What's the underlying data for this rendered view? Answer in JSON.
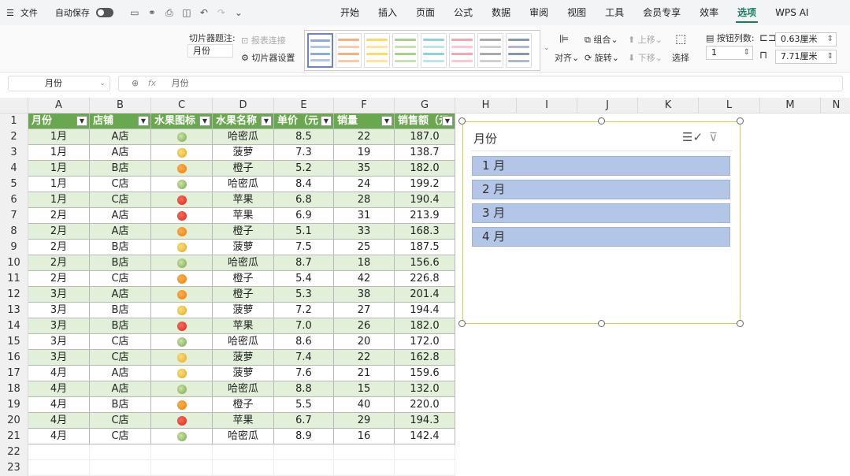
{
  "menubar": {
    "hamburger": "☰",
    "file": "文件",
    "autosave": "自动保存",
    "tabs": [
      "开始",
      "插入",
      "页面",
      "公式",
      "数据",
      "审阅",
      "视图",
      "工具",
      "会员专享",
      "效率",
      "选项",
      "WPS AI"
    ],
    "active_tab": "选项"
  },
  "ribbon": {
    "caption_label": "切片器题注:",
    "caption_value": "月份",
    "report_connect": "报表连接",
    "slicer_settings": "切片器设置",
    "align": "对齐",
    "group": "组合",
    "rotate": "旋转",
    "move_up": "上移",
    "move_down": "下移",
    "select": "选择",
    "button_cols_label": "按钮列数:",
    "button_cols_value": "1",
    "height_value": "0.63厘米",
    "width_value": "7.71厘米"
  },
  "formula_bar": {
    "name_box": "月份",
    "fx": "fx",
    "value": "月份"
  },
  "columns": [
    "A",
    "B",
    "C",
    "D",
    "E",
    "F",
    "G",
    "H",
    "I",
    "J",
    "K",
    "L",
    "M",
    "N"
  ],
  "table": {
    "headers": [
      "月份",
      "店铺",
      "水果图标",
      "水果名称",
      "单价（元",
      "销量",
      "销售额（元"
    ],
    "rows": [
      [
        "1月",
        "A店",
        "melon",
        "哈密瓜",
        "8.5",
        "22",
        "187.0"
      ],
      [
        "1月",
        "A店",
        "pine",
        "菠萝",
        "7.3",
        "19",
        "138.7"
      ],
      [
        "1月",
        "B店",
        "orange",
        "橙子",
        "5.2",
        "35",
        "182.0"
      ],
      [
        "1月",
        "C店",
        "melon",
        "哈密瓜",
        "8.4",
        "24",
        "199.2"
      ],
      [
        "1月",
        "C店",
        "apple",
        "苹果",
        "6.8",
        "28",
        "190.4"
      ],
      [
        "2月",
        "A店",
        "apple",
        "苹果",
        "6.9",
        "31",
        "213.9"
      ],
      [
        "2月",
        "A店",
        "orange",
        "橙子",
        "5.1",
        "33",
        "168.3"
      ],
      [
        "2月",
        "B店",
        "pine",
        "菠萝",
        "7.5",
        "25",
        "187.5"
      ],
      [
        "2月",
        "B店",
        "melon",
        "哈密瓜",
        "8.7",
        "18",
        "156.6"
      ],
      [
        "2月",
        "C店",
        "orange",
        "橙子",
        "5.4",
        "42",
        "226.8"
      ],
      [
        "3月",
        "A店",
        "orange",
        "橙子",
        "5.3",
        "38",
        "201.4"
      ],
      [
        "3月",
        "B店",
        "pine",
        "菠萝",
        "7.2",
        "27",
        "194.4"
      ],
      [
        "3月",
        "B店",
        "apple",
        "苹果",
        "7.0",
        "26",
        "182.0"
      ],
      [
        "3月",
        "C店",
        "melon",
        "哈密瓜",
        "8.6",
        "20",
        "172.0"
      ],
      [
        "3月",
        "C店",
        "pine",
        "菠萝",
        "7.4",
        "22",
        "162.8"
      ],
      [
        "4月",
        "A店",
        "pine",
        "菠萝",
        "7.6",
        "21",
        "159.6"
      ],
      [
        "4月",
        "A店",
        "melon",
        "哈密瓜",
        "8.8",
        "15",
        "132.0"
      ],
      [
        "4月",
        "B店",
        "orange",
        "橙子",
        "5.5",
        "40",
        "220.0"
      ],
      [
        "4月",
        "C店",
        "apple",
        "苹果",
        "6.7",
        "29",
        "194.3"
      ],
      [
        "4月",
        "C店",
        "melon",
        "哈密瓜",
        "8.9",
        "16",
        "142.4"
      ]
    ]
  },
  "row_numbers": [
    "1",
    "2",
    "3",
    "4",
    "5",
    "6",
    "7",
    "8",
    "9",
    "10",
    "11",
    "12",
    "13",
    "14",
    "15",
    "16",
    "17",
    "18",
    "19",
    "20",
    "21",
    "22",
    "23"
  ],
  "slicer": {
    "title": "月份",
    "items": [
      "1 月",
      "2 月",
      "3 月",
      "4 月"
    ]
  },
  "colors": {
    "header_green": "#6aa84f",
    "band_green": "#e2efd9",
    "slicer_item": "#b3c6e7",
    "active_tab": "#1a7f5a"
  }
}
